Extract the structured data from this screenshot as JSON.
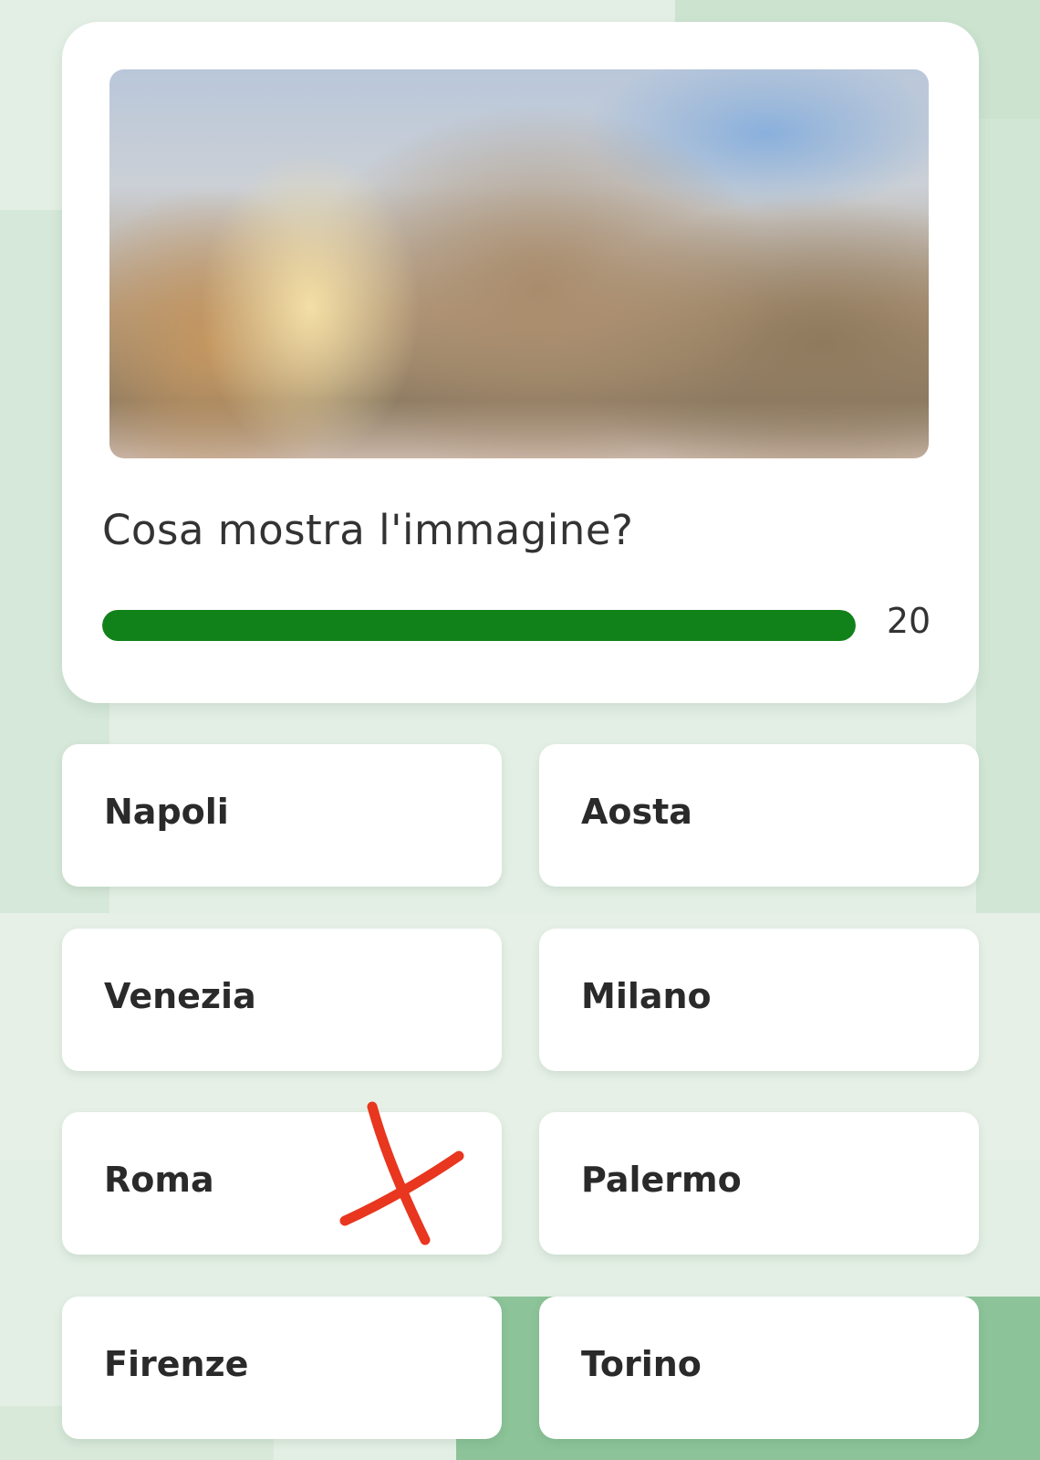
{
  "quiz": {
    "question": "Cosa mostra l'immagine?",
    "timer": {
      "remaining": "20",
      "progress": 1.0,
      "color": "#118219"
    },
    "answers": [
      {
        "label": "Napoli"
      },
      {
        "label": "Aosta"
      },
      {
        "label": "Venezia"
      },
      {
        "label": "Milano"
      },
      {
        "label": "Roma"
      },
      {
        "label": "Palermo"
      },
      {
        "label": "Firenze"
      },
      {
        "label": "Torino"
      }
    ]
  },
  "annotation": {
    "type": "handwritten-x-mark",
    "color": "#e8361f",
    "on_answer": "Roma"
  }
}
